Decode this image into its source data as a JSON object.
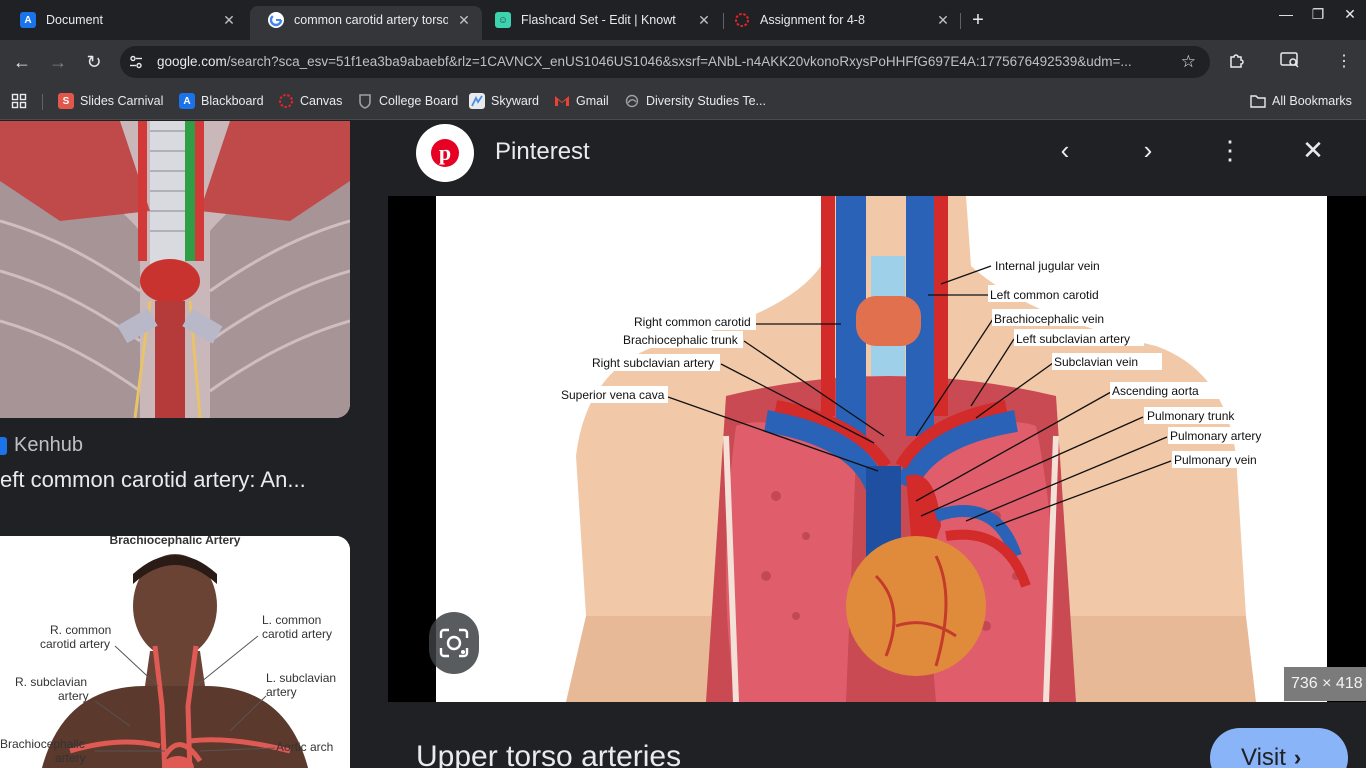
{
  "tabs": [
    {
      "title": "Document",
      "favicon": "google-docs-blackboard-icon"
    },
    {
      "title": "common carotid artery torso m",
      "favicon": "google-icon"
    },
    {
      "title": "Flashcard Set - Edit | Knowt",
      "favicon": "knowt-icon"
    },
    {
      "title": "Assignment for 4-8",
      "favicon": "canvas-icon"
    }
  ],
  "toolbar": {
    "url_host": "google.com",
    "url_rest": "/search?sca_esv=51f1ea3ba9abaebf&rlz=1CAVNCX_enUS1046US1046&sxsrf=ANbL-n4AKK20vkonoRxysPoHHFfG697E4A:1775676492539&udm=..."
  },
  "bookmarks": [
    {
      "label": "Slides Carnival",
      "color": "#e2574c"
    },
    {
      "label": "Blackboard",
      "color": "#1a73e8"
    },
    {
      "label": "Canvas",
      "color": "#e72429"
    },
    {
      "label": "College Board",
      "color": "#9aa0a6"
    },
    {
      "label": "Skyward",
      "color": "#4a90e2"
    },
    {
      "label": "Gmail",
      "color": "#ea4335"
    },
    {
      "label": "Diversity Studies Te...",
      "color": "#9aa0a6"
    }
  ],
  "all_bookmarks": "All Bookmarks",
  "results": {
    "source": "Kenhub",
    "caption": "eft common carotid artery: An...",
    "thumb2_labels": {
      "title": "Brachiocephalic Artery",
      "r_common": [
        "R. common",
        "carotid artery"
      ],
      "l_common": [
        "L. common",
        "carotid artery"
      ],
      "r_subclavian": [
        "R. subclavian",
        "artery"
      ],
      "l_subclavian": [
        "L. subclavian",
        "artery"
      ],
      "brachiocephalic": [
        "Brachiocephalic",
        "artery"
      ],
      "aortic_arch": "Aortic arch"
    }
  },
  "panel": {
    "source": "Pinterest",
    "dimensions": "736 × 418",
    "title": "Upper torso arteries",
    "visit": "Visit"
  },
  "figure_labels": {
    "internal_jugular_vein": "Internal jugular vein",
    "left_common_carotid": "Left common carotid",
    "right_common_carotid": "Right common carotid",
    "brachiocephalic_vein": "Brachiocephalic vein",
    "brachiocephalic_trunk": "Brachiocephalic trunk",
    "left_subclavian_artery": "Left subclavian artery",
    "right_subclavian_artery": "Right subclavian artery",
    "subclavian_vein": "Subclavian vein",
    "superior_vena_cava": "Superior vena cava",
    "ascending_aorta": "Ascending aorta",
    "pulmonary_trunk": "Pulmonary trunk",
    "pulmonary_artery": "Pulmonary artery",
    "pulmonary_vein": "Pulmonary vein"
  },
  "colors": {
    "accent": "#8ab4f8",
    "pinterest": "#e60023",
    "chrome_dark": "#202124",
    "chrome_toolbar": "#35363a"
  }
}
